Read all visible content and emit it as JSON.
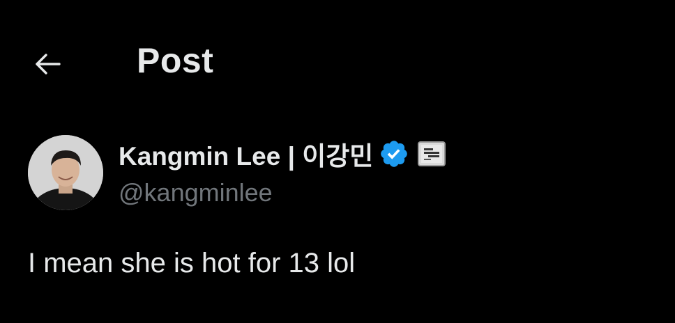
{
  "header": {
    "title": "Post",
    "back_icon": "arrow-left-icon"
  },
  "author": {
    "display_name": "Kangmin Lee | 이강민",
    "handle": "@kangminlee",
    "verified_icon": "verified-badge-icon",
    "affiliate_icon": "affiliate-logo-icon",
    "avatar_icon": "avatar-photo"
  },
  "post": {
    "text": "I mean she is hot for 13 lol"
  },
  "colors": {
    "background": "#000000",
    "primary_text": "#e7e9ea",
    "secondary_text": "#71767b",
    "verified_blue": "#1d9bf0"
  }
}
